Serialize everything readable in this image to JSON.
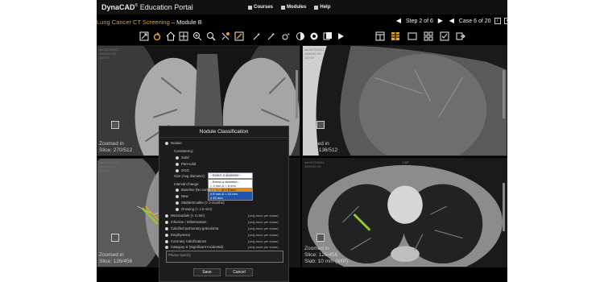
{
  "header": {
    "brand_bold": "Dyna",
    "brand_cad": "CAD",
    "brand_reg": "®",
    "brand_portal": " Education Portal",
    "nav": [
      {
        "label": "Courses",
        "icon": "book-icon"
      },
      {
        "label": "Modules",
        "icon": "grid-icon"
      },
      {
        "label": "Help",
        "icon": "help-icon"
      }
    ]
  },
  "module": {
    "title": "Lung Cancer CT Screening",
    "separator": " – ",
    "subtitle": "Module B",
    "step_text": "Step 2 of 6",
    "case_text": "Case 6 of 20"
  },
  "toolbar": {
    "tools": [
      "fit-icon",
      "rotate-icon",
      "home-icon",
      "crosshair-icon",
      "zoom-in-icon",
      "magnifier-icon",
      "pan-icon",
      "measure-icon",
      "roi-icon",
      "annotate-icon",
      "invert-icon",
      "window-level-icon",
      "cine-icon",
      "play-icon"
    ],
    "right_tools": [
      "layout-1-icon",
      "layout-stack-icon",
      "layout-single-icon",
      "layout-grid-icon",
      "checklist-icon",
      "exit-icon"
    ]
  },
  "viewports": [
    {
      "meta": "ser4073/0001\n100/100 H2\n120 kV",
      "zoom_label": "Zoomed in",
      "slice": "Slice: 270/512"
    },
    {
      "meta": "ser4073/0001\n100/100 H2\n120 kV",
      "zoom_label": "Zoomed in",
      "slice": "Slice: 136/512"
    },
    {
      "meta": "ser4073/0001\n100/100 H2\n120 kV",
      "zoom_label": "Zoomed in",
      "slice": "Slice: 126/456"
    },
    {
      "meta": "ser4073/0001\n100/100 H2",
      "scale": "100 mm",
      "lbl": "LSP",
      "zoom_label": "Zoomed in",
      "slice": "Slice: 126/456",
      "slab": "Slab: 10 mm (MIP)"
    }
  ],
  "modal": {
    "title": "Nodule Classification",
    "nodule": "Nodule",
    "consistency": "Consistency:",
    "solid": "Solid",
    "part_solid": "Part-solid",
    "ggo": "GGO",
    "size_label": "Size (Avg diameter):",
    "select_value": "--Select a diameter--",
    "dropdown": [
      "--Select a diameter--",
      "< 4 mm & < 6 mm",
      "≥ 6 mm & < 8 mm",
      "≥ 8 mm & < 15 mm",
      "≥ 15 mm"
    ],
    "interval": "Interval Change:",
    "baseline": "Baseline (No comparison)",
    "new": "New",
    "stable": "Stable/Smaller (> 3 months)",
    "growing": "Growing (> 1.5 mm)",
    "micronodule": "Micronodule (< 4 mm)",
    "infection": "Infection / Inflammation",
    "calcified": "Calcified pulmonary granuloma",
    "emphysema": "Emphysema",
    "coronary": "Coronary Calcifications",
    "category5": "Category S (Significant Incidental)",
    "once_note": "(only once per exam)",
    "specify_placeholder": "Please specify",
    "save": "Save",
    "cancel": "Cancel"
  }
}
